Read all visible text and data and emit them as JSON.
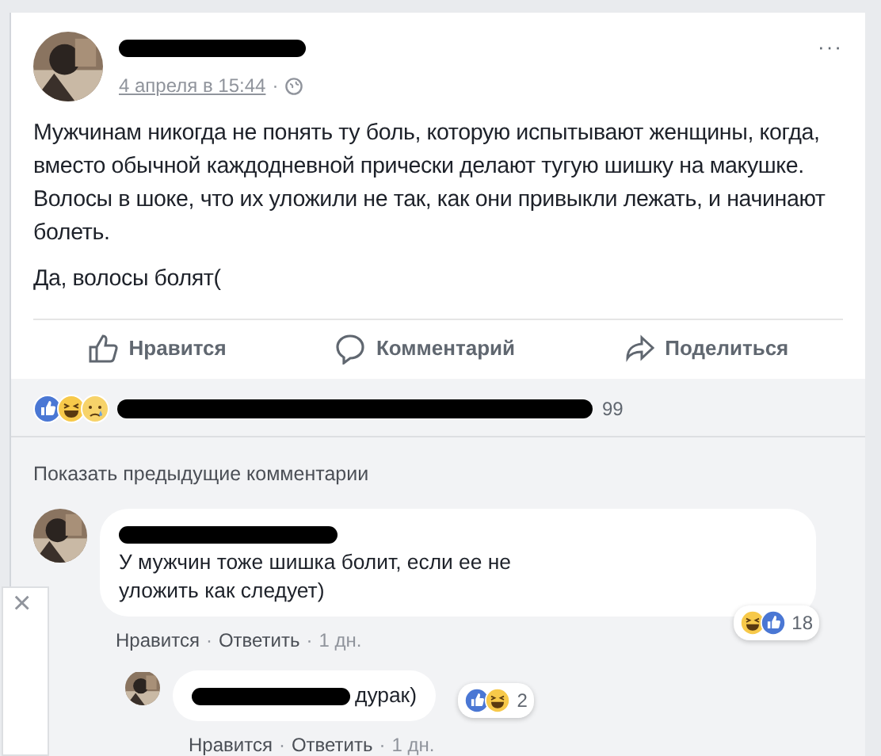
{
  "post": {
    "date": "4 апреля в 15:44",
    "date_separator": "·",
    "menu": "···",
    "paragraphs": [
      "Мужчинам никогда не понять ту боль, которую испытывают женщины, когда, вместо обычной каждодневной прически делают тугую шишку на макушке. Волосы в шоке, что их уложили не так, как они привыкли лежать, и начинают болеть.",
      "Да, волосы болят("
    ],
    "actions": [
      {
        "kind": "like",
        "label": "Нравится"
      },
      {
        "kind": "comment",
        "label": "Комментарий"
      },
      {
        "kind": "share",
        "label": "Поделиться"
      }
    ]
  },
  "reactions": {
    "types": [
      {
        "kind": "like"
      },
      {
        "kind": "haha"
      },
      {
        "kind": "sad"
      }
    ],
    "count": "99"
  },
  "show_previous": "Показать предыдущие комментарии",
  "comments": [
    {
      "text": "У мужчин тоже шишка болит, если ее не уложить как следует)",
      "reactions": [
        {
          "kind": "haha"
        },
        {
          "kind": "like"
        }
      ],
      "count": "18",
      "meta": [
        {
          "kind": "link",
          "text": "Нравится"
        },
        {
          "kind": "sep",
          "text": "·"
        },
        {
          "kind": "link",
          "text": "Ответить"
        },
        {
          "kind": "sep",
          "text": "·"
        },
        {
          "kind": "time",
          "text": "1 дн."
        }
      ],
      "replies": [
        {
          "text": "дурак)",
          "reactions": [
            {
              "kind": "like"
            },
            {
              "kind": "haha"
            }
          ],
          "count": "2",
          "meta": [
            {
              "kind": "link",
              "text": "Нравится"
            },
            {
              "kind": "sep",
              "text": "·"
            },
            {
              "kind": "link",
              "text": "Ответить"
            },
            {
              "kind": "sep",
              "text": "·"
            },
            {
              "kind": "time",
              "text": "1 дн."
            }
          ]
        }
      ]
    }
  ],
  "side_panel": {
    "close": "×"
  }
}
